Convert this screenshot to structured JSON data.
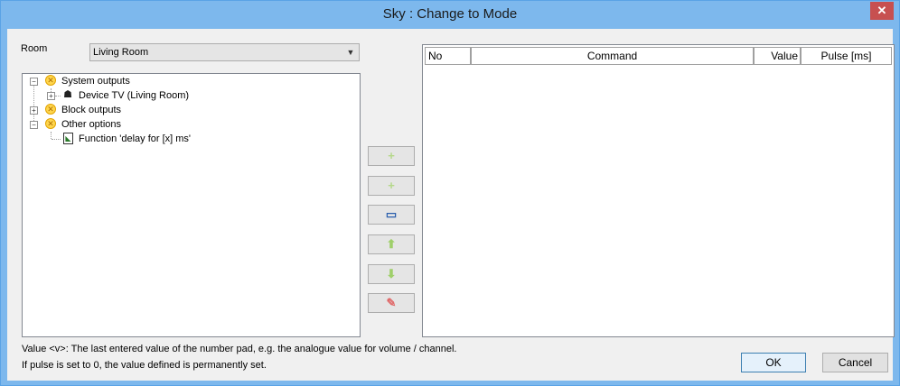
{
  "window": {
    "title": "Sky : Change to Mode",
    "close_glyph": "✕"
  },
  "room": {
    "label": "Room",
    "selected": "Living Room"
  },
  "tree": {
    "items": [
      {
        "label": "System outputs",
        "icon": "output-group-icon",
        "expanded": true
      },
      {
        "label": "Device TV (Living Room)",
        "icon": "light-device-icon",
        "expanded": false
      },
      {
        "label": "Block outputs",
        "icon": "output-group-icon",
        "expanded": false
      },
      {
        "label": "Other options",
        "icon": "output-group-icon",
        "expanded": true
      },
      {
        "label": "Function 'delay for [x] ms'",
        "icon": "function-icon"
      }
    ]
  },
  "toolbar": {
    "add_glyph": "+",
    "add_sub_glyph": "+",
    "edit_glyph": "▭",
    "up_glyph": "⬆",
    "down_glyph": "⬇",
    "delete_glyph": "✎"
  },
  "grid": {
    "columns": [
      "No",
      "Command",
      "Value",
      "Pulse [ms]"
    ],
    "rows": []
  },
  "footnotes": [
    "Value <v>: The last entered value of the number pad, e.g. the analogue value for volume / channel.",
    "If pulse is set to 0, the value defined is permanently set."
  ],
  "buttons": {
    "ok": "OK",
    "cancel": "Cancel"
  },
  "colors": {
    "titlebar": "#7db8ed",
    "close": "#c75050",
    "accent_green": "#8cc63f"
  }
}
